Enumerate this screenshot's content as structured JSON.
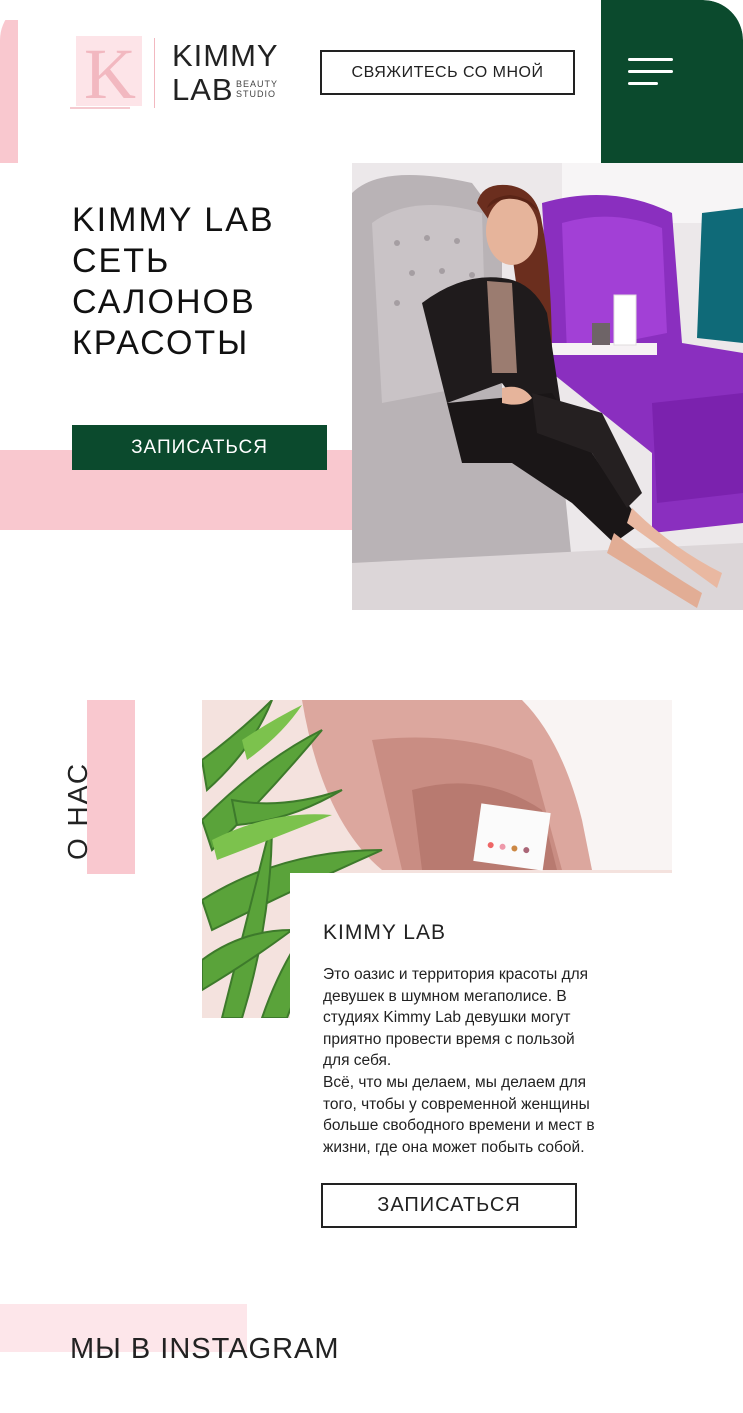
{
  "header": {
    "logo_top": "KIMMY",
    "logo_bottom": "LAB",
    "logo_sub_1": "BEAUTY",
    "logo_sub_2": "STUDIO",
    "logo_letter": "K",
    "contact_label": "СВЯЖИТЕСЬ СО МНОЙ"
  },
  "hero": {
    "title_lines": [
      "KIMMY LAB",
      "СЕТЬ",
      "САЛОНОВ",
      "КРАСОТЫ"
    ],
    "cta_label": "ЗАПИСАТЬСЯ"
  },
  "about": {
    "section_label": "О НАС",
    "heading": "KIMMY LAB",
    "paragraph_1": "Это оазис и территория красоты для\nдевушек в шумном мегаполисе. В\nстудиях Kimmy Lab  девушки могут\nприятно провести время с пользой\nдля себя.",
    "paragraph_2": "Всё, что мы делаем, мы делаем для\nтого, чтобы у современной женщины\nбольше свободного времени и мест в\nжизни, где она может побыть собой.",
    "cta_label": "ЗАПИСАТЬСЯ"
  },
  "instagram": {
    "title": "МЫ В INSTAGRAM"
  },
  "colors": {
    "brand_green": "#0b4a2d",
    "brand_pink": "#f9c8cf",
    "logo_pink": "#f2b8c0"
  }
}
